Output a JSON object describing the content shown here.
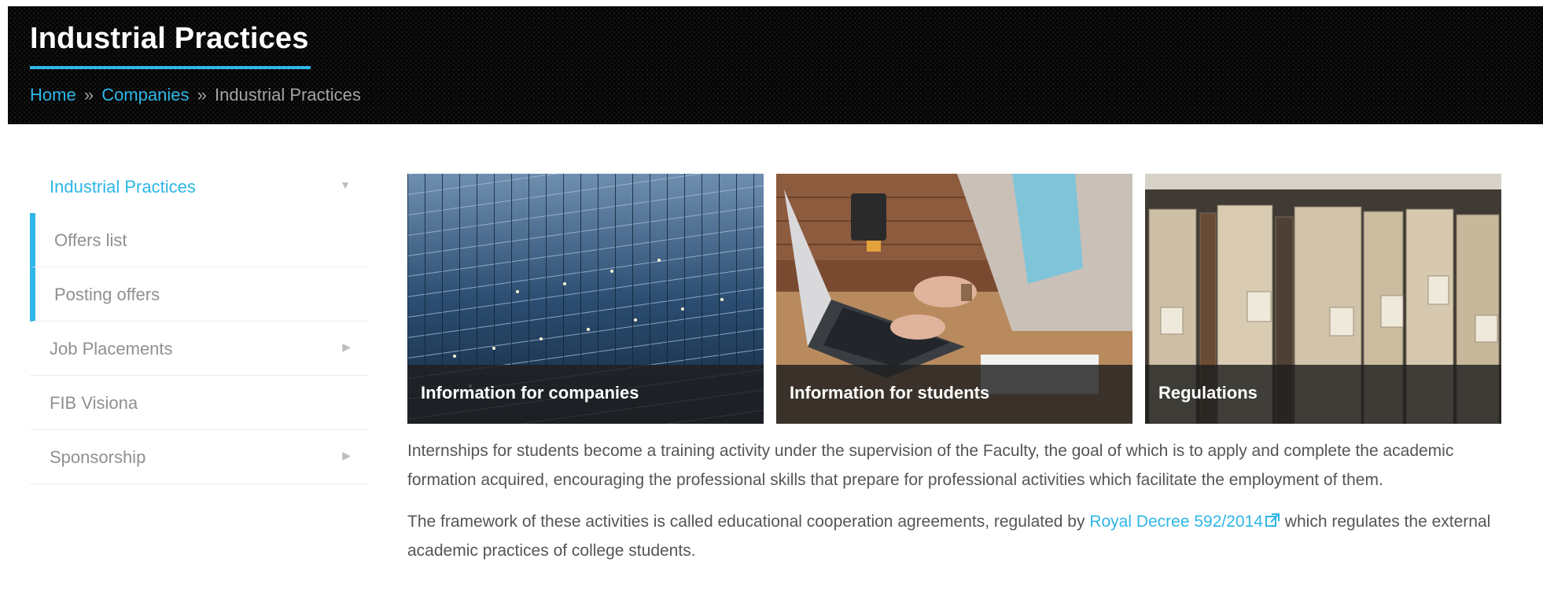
{
  "header": {
    "title": "Industrial Practices",
    "breadcrumb": {
      "home": "Home",
      "sep1": "»",
      "companies": "Companies",
      "sep2": "»",
      "current": "Industrial Practices"
    }
  },
  "sidebar": {
    "items": [
      {
        "label": "Industrial Practices",
        "arrow": "▼"
      },
      {
        "label": "Offers list"
      },
      {
        "label": "Posting offers"
      },
      {
        "label": "Job Placements",
        "arrow": "▶"
      },
      {
        "label": "FIB Visiona"
      },
      {
        "label": "Sponsorship",
        "arrow": "▶"
      }
    ]
  },
  "cards": [
    {
      "caption": "Information for companies",
      "icon": "office-building-photo"
    },
    {
      "caption": "Information for students",
      "icon": "laptop-typing-photo"
    },
    {
      "caption": "Regulations",
      "icon": "archive-folders-photo"
    }
  ],
  "content": {
    "paragraph1": "Internships for students become a training activity under the supervision of the Faculty, the goal of which is to apply and complete the academic formation acquired, encouraging the professional skills that prepare for professional activities which facilitate the employment of them.",
    "paragraph2_before": "The framework of these activities is called educational cooperation agreements, regulated by ",
    "paragraph2_link": "Royal Decree 592/2014",
    "paragraph2_after": " which regulates the external academic practices of college students."
  },
  "colors": {
    "accent": "#2eb6e8",
    "banner": "#050505",
    "text": "#555555"
  }
}
